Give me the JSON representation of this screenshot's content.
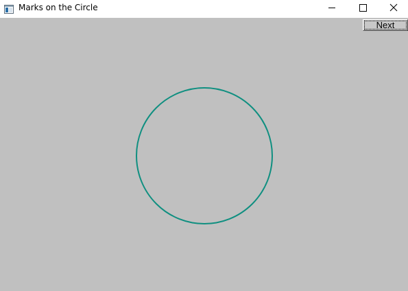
{
  "window": {
    "title": "Marks on the Circle",
    "icon": "app-window-icon",
    "controls": [
      "minimize-icon",
      "maximize-icon",
      "close-icon"
    ]
  },
  "toolbar": {
    "next_label": "Next"
  },
  "canvas": {
    "background": "#c0c0c0",
    "circle_color": "#0f8f80"
  }
}
